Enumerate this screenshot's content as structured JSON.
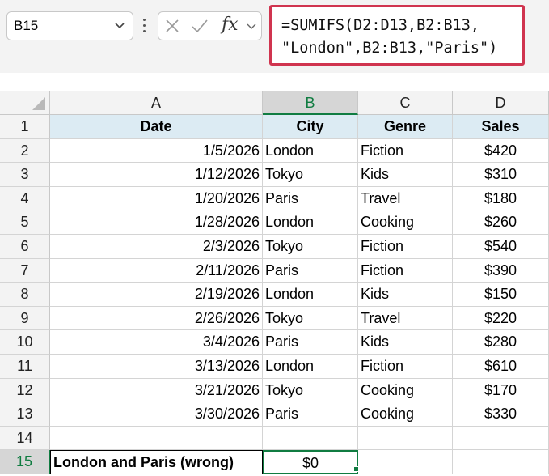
{
  "name_box": {
    "value": "B15",
    "dropdown_icon": "chevron-down-icon"
  },
  "formula_bar": {
    "cancel_icon": "close-icon",
    "enter_icon": "checkmark-icon",
    "fx_label": "fx",
    "formula_line1": "=SUMIFS(D2:D13,B2:B13,",
    "formula_line2": "\"London\",B2:B13,\"Paris\")",
    "highlight_color": "#d0344f"
  },
  "column_headers": [
    "A",
    "B",
    "C",
    "D"
  ],
  "row_numbers": [
    "1",
    "2",
    "3",
    "4",
    "5",
    "6",
    "7",
    "8",
    "9",
    "10",
    "11",
    "12",
    "13",
    "14",
    "15"
  ],
  "table": {
    "headers": [
      "Date",
      "City",
      "Genre",
      "Sales"
    ],
    "rows": [
      [
        "1/5/2026",
        "London",
        "Fiction",
        "$420"
      ],
      [
        "1/12/2026",
        "Tokyo",
        "Kids",
        "$310"
      ],
      [
        "1/20/2026",
        "Paris",
        "Travel",
        "$180"
      ],
      [
        "1/28/2026",
        "London",
        "Cooking",
        "$260"
      ],
      [
        "2/3/2026",
        "Tokyo",
        "Fiction",
        "$540"
      ],
      [
        "2/11/2026",
        "Paris",
        "Fiction",
        "$390"
      ],
      [
        "2/19/2026",
        "London",
        "Kids",
        "$150"
      ],
      [
        "2/26/2026",
        "Tokyo",
        "Travel",
        "$220"
      ],
      [
        "3/4/2026",
        "Paris",
        "Kids",
        "$280"
      ],
      [
        "3/13/2026",
        "London",
        "Fiction",
        "$610"
      ],
      [
        "3/21/2026",
        "Tokyo",
        "Cooking",
        "$170"
      ],
      [
        "3/30/2026",
        "Paris",
        "Cooking",
        "$330"
      ]
    ]
  },
  "result_row": {
    "label": "London and Paris (wrong)",
    "value": "$0"
  },
  "colors": {
    "header_fill": "#dcebf3",
    "selection": "#107c41"
  }
}
